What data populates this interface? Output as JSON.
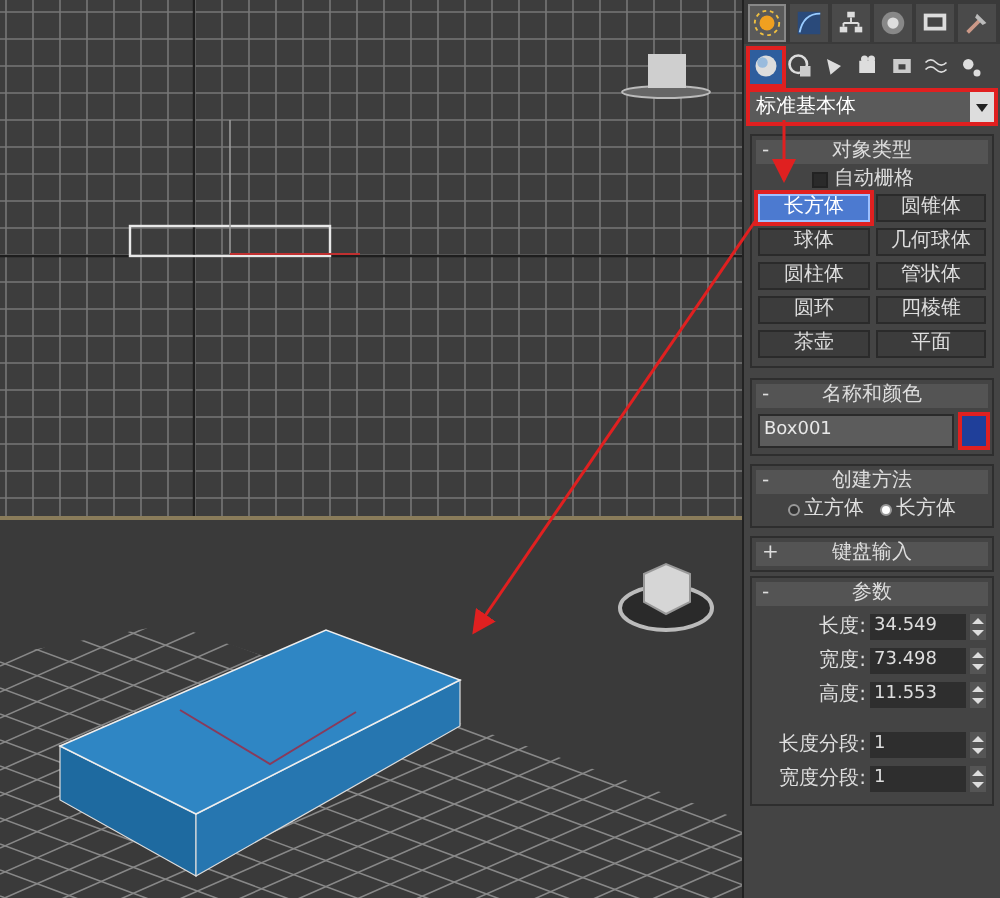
{
  "command_panel": {
    "tabs": [
      {
        "selected": true
      },
      {
        "selected": false
      },
      {
        "selected": false
      },
      {
        "selected": false
      },
      {
        "selected": false
      },
      {
        "selected": false
      }
    ],
    "categories": [
      {
        "selected": true,
        "highlighted": true
      },
      {
        "selected": false,
        "highlighted": false
      },
      {
        "selected": false,
        "highlighted": false
      },
      {
        "selected": false,
        "highlighted": false
      },
      {
        "selected": false,
        "highlighted": false
      },
      {
        "selected": false,
        "highlighted": false
      },
      {
        "selected": false,
        "highlighted": false
      }
    ],
    "dropdown": {
      "value": "标准基本体",
      "highlighted": true
    },
    "object_type": {
      "toggle": "-",
      "title": "对象类型",
      "autogrid": {
        "label": "自动栅格",
        "checked": false
      },
      "buttons": [
        {
          "label": "长方体",
          "selected": true,
          "highlighted": true
        },
        {
          "label": "圆锥体",
          "selected": false,
          "highlighted": false
        },
        {
          "label": "球体",
          "selected": false,
          "highlighted": false
        },
        {
          "label": "几何球体",
          "selected": false,
          "highlighted": false
        },
        {
          "label": "圆柱体",
          "selected": false,
          "highlighted": false
        },
        {
          "label": "管状体",
          "selected": false,
          "highlighted": false
        },
        {
          "label": "圆环",
          "selected": false,
          "highlighted": false
        },
        {
          "label": "四棱锥",
          "selected": false,
          "highlighted": false
        },
        {
          "label": "茶壶",
          "selected": false,
          "highlighted": false
        },
        {
          "label": "平面",
          "selected": false,
          "highlighted": false
        }
      ]
    },
    "name_color": {
      "toggle": "-",
      "title": "名称和颜色",
      "name": "Box001",
      "color": "#1f3f9a",
      "highlighted": true
    },
    "creation_method": {
      "toggle": "-",
      "title": "创建方法",
      "options": [
        {
          "label": "立方体",
          "selected": false
        },
        {
          "label": "长方体",
          "selected": true
        }
      ]
    },
    "keyboard_entry": {
      "toggle": "+",
      "title": "键盘输入"
    },
    "parameters": {
      "toggle": "-",
      "title": "参数",
      "field_groups": [
        [
          {
            "label": "长度:",
            "value": "34.549"
          },
          {
            "label": "宽度:",
            "value": "73.498"
          },
          {
            "label": "高度:",
            "value": "11.553"
          }
        ],
        [
          {
            "label": "长度分段:",
            "value": "1"
          },
          {
            "label": "宽度分段:",
            "value": "1"
          }
        ]
      ]
    }
  }
}
